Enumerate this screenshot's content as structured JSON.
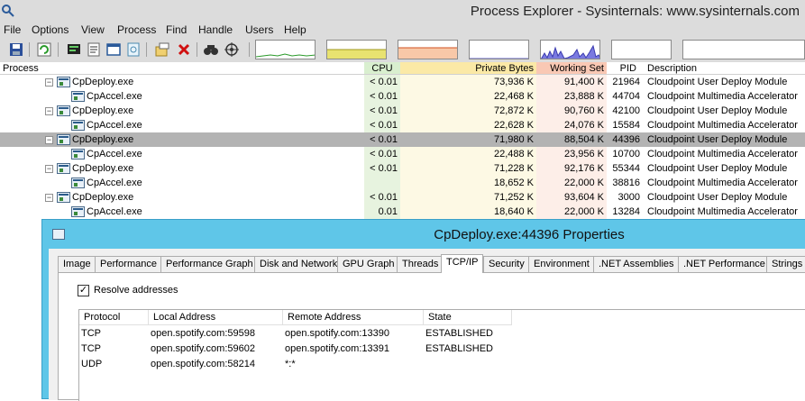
{
  "window": {
    "title": "Process Explorer - Sysinternals: www.sysinternals.com"
  },
  "menu": [
    "File",
    "Options",
    "View",
    "Process",
    "Find",
    "Handle",
    "Users",
    "Help"
  ],
  "columns": {
    "process": "Process",
    "cpu": "CPU",
    "private_bytes": "Private Bytes",
    "working_set": "Working Set",
    "pid": "PID",
    "description": "Description"
  },
  "processes": [
    {
      "name": "CpDeploy.exe",
      "level": 0,
      "cpu": "< 0.01",
      "private_bytes": "73,936 K",
      "working_set": "91,400 K",
      "pid": "21964",
      "description": "Cloudpoint User Deploy Module",
      "selected": false
    },
    {
      "name": "CpAccel.exe",
      "level": 1,
      "cpu": "< 0.01",
      "private_bytes": "22,468 K",
      "working_set": "23,888 K",
      "pid": "44704",
      "description": "Cloudpoint Multimedia Accelerator",
      "selected": false
    },
    {
      "name": "CpDeploy.exe",
      "level": 0,
      "cpu": "< 0.01",
      "private_bytes": "72,872 K",
      "working_set": "90,760 K",
      "pid": "42100",
      "description": "Cloudpoint User Deploy Module",
      "selected": false
    },
    {
      "name": "CpAccel.exe",
      "level": 1,
      "cpu": "< 0.01",
      "private_bytes": "22,628 K",
      "working_set": "24,076 K",
      "pid": "15584",
      "description": "Cloudpoint Multimedia Accelerator",
      "selected": false
    },
    {
      "name": "CpDeploy.exe",
      "level": 0,
      "cpu": "< 0.01",
      "private_bytes": "71,980 K",
      "working_set": "88,504 K",
      "pid": "44396",
      "description": "Cloudpoint User Deploy Module",
      "selected": true
    },
    {
      "name": "CpAccel.exe",
      "level": 1,
      "cpu": "< 0.01",
      "private_bytes": "22,488 K",
      "working_set": "23,956 K",
      "pid": "10700",
      "description": "Cloudpoint Multimedia Accelerator",
      "selected": false
    },
    {
      "name": "CpDeploy.exe",
      "level": 0,
      "cpu": "< 0.01",
      "private_bytes": "71,228 K",
      "working_set": "92,176 K",
      "pid": "55344",
      "description": "Cloudpoint User Deploy Module",
      "selected": false
    },
    {
      "name": "CpAccel.exe",
      "level": 1,
      "cpu": "",
      "private_bytes": "18,652 K",
      "working_set": "22,000 K",
      "pid": "38816",
      "description": "Cloudpoint Multimedia Accelerator",
      "selected": false
    },
    {
      "name": "CpDeploy.exe",
      "level": 0,
      "cpu": "< 0.01",
      "private_bytes": "71,252 K",
      "working_set": "93,604 K",
      "pid": "3000",
      "description": "Cloudpoint User Deploy Module",
      "selected": false
    },
    {
      "name": "CpAccel.exe",
      "level": 1,
      "cpu": "0.01",
      "private_bytes": "18,640 K",
      "working_set": "22,000 K",
      "pid": "13284",
      "description": "Cloudpoint Multimedia Accelerator",
      "selected": false
    }
  ],
  "dialog": {
    "title": "CpDeploy.exe:44396 Properties",
    "tabs": [
      "Image",
      "Performance",
      "Performance Graph",
      "Disk and Network",
      "GPU Graph",
      "Threads",
      "TCP/IP",
      "Security",
      "Environment",
      ".NET Assemblies",
      ".NET Performance",
      "Strings"
    ],
    "active_tab": "TCP/IP",
    "resolve_addresses_label": "Resolve addresses",
    "resolve_addresses_checked": true,
    "list_headers": {
      "protocol": "Protocol",
      "local": "Local Address",
      "remote": "Remote Address",
      "state": "State"
    },
    "connections": [
      {
        "protocol": "TCP",
        "local": "open.spotify.com:59598",
        "remote": "open.spotify.com:13390",
        "state": "ESTABLISHED"
      },
      {
        "protocol": "TCP",
        "local": "open.spotify.com:59602",
        "remote": "open.spotify.com:13391",
        "state": "ESTABLISHED"
      },
      {
        "protocol": "UDP",
        "local": "open.spotify.com:58214",
        "remote": "*:*",
        "state": ""
      }
    ]
  },
  "icons": {
    "app": "process-explorer-icon",
    "toolbar": [
      "save-icon",
      "refresh-icon",
      "system-info-icon",
      "properties-icon",
      "window-icon",
      "dll-view-icon",
      "target-icon",
      "kill-process-icon",
      "find-icon",
      "crosshair-icon"
    ]
  },
  "colors": {
    "selected_row": "#b3b3b3",
    "cpu_column": "#e7f3df",
    "private_bytes_column": "#fdf9e4",
    "working_set_column": "#fdeee8",
    "dialog_frame": "#5fc6e8"
  }
}
